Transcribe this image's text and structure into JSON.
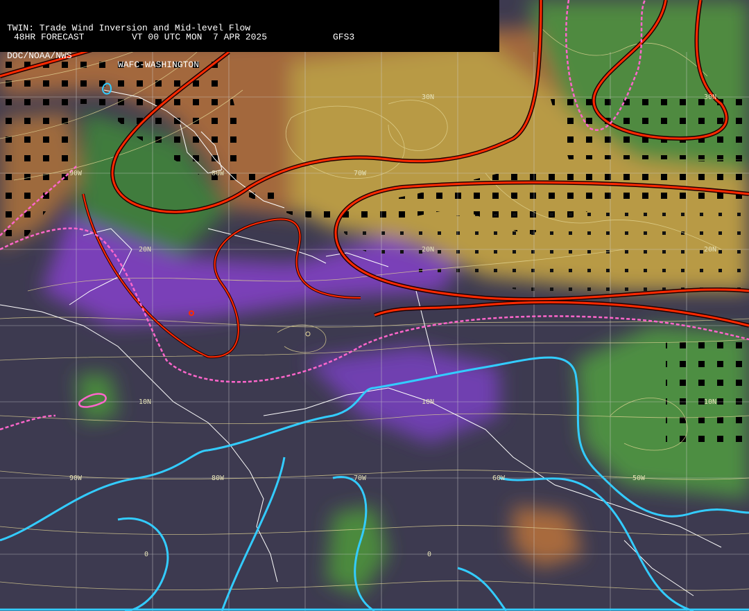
{
  "header": {
    "title": "TWIN: Trade Wind Inversion and Mid-level Flow",
    "forecast": "48HR FORECAST",
    "valid_time": "VT 00 UTC MON  7 APR 2025",
    "model": "GFS3",
    "agency": "DOC/NOAA/NWS",
    "center": "WAFC-WASHINGTON"
  },
  "grid_labels": {
    "lat": [
      "30N",
      "20N",
      "20N",
      "20N",
      "10N",
      "10N",
      "10N",
      "30N"
    ],
    "lon": [
      "90W",
      "80W",
      "70W",
      "90W",
      "80W",
      "70W",
      "60W",
      "50W"
    ],
    "zero": [
      "0",
      "0"
    ]
  },
  "colors": {
    "inversion_contour": "#ff2a00",
    "dashed_contour": "#ff66cc",
    "moisture_contour": "#33ccff",
    "gridline": "#d8d8d8",
    "streamline": "#e6d89a",
    "coastline": "#ffffff",
    "high_zone": "#a86a3c",
    "mid_zone": "#b8943e",
    "green_zone": "#4c8a3e",
    "low_zone": "#3c3650",
    "purple_zone": "#7b3fb8"
  }
}
